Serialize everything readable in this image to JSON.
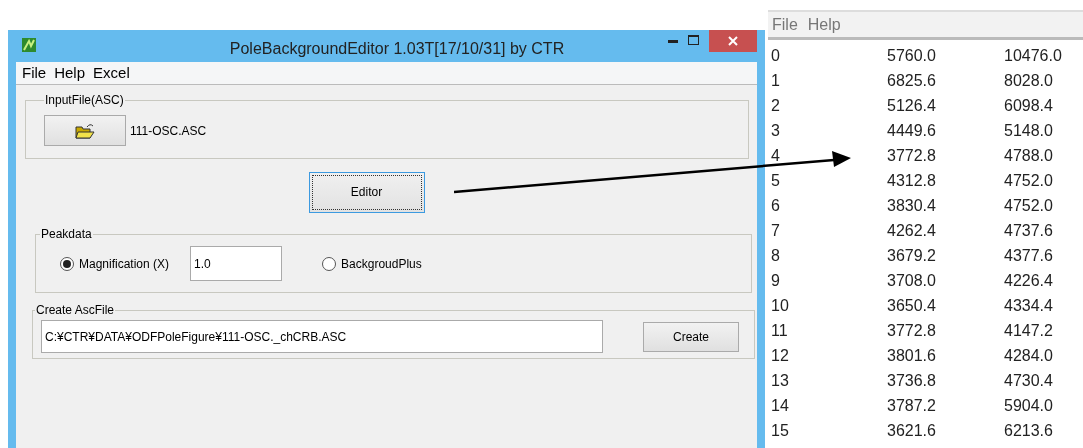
{
  "window": {
    "title": "PoleBackgroundEditor 1.03T[17/10/31] by CTR"
  },
  "menu": [
    "File",
    "Help",
    "Excel"
  ],
  "input_group": {
    "label": "InputFile(ASC)",
    "file_name": "111-OSC.ASC"
  },
  "editor_button": "Editor",
  "peakdata": {
    "label": "Peakdata",
    "options": [
      {
        "label": "Magnification (X)",
        "selected": true,
        "value": "1.0"
      },
      {
        "label": "BackgroudPlus",
        "selected": false
      }
    ]
  },
  "create_group": {
    "label": "Create AscFile",
    "path": "C:¥CTR¥DATA¥ODFPoleFigure¥111-OSC._chCRB.ASC",
    "button": "Create"
  },
  "data_window": {
    "menu": [
      "File",
      "Help"
    ],
    "rows": [
      [
        "0",
        "5760.0",
        "10476.0"
      ],
      [
        "1",
        "6825.6",
        "8028.0"
      ],
      [
        "2",
        "5126.4",
        "6098.4"
      ],
      [
        "3",
        "4449.6",
        "5148.0"
      ],
      [
        "4",
        "3772.8",
        "4788.0"
      ],
      [
        "5",
        "4312.8",
        "4752.0"
      ],
      [
        "6",
        "3830.4",
        "4752.0"
      ],
      [
        "7",
        "4262.4",
        "4737.6"
      ],
      [
        "8",
        "3679.2",
        "4377.6"
      ],
      [
        "9",
        "3708.0",
        "4226.4"
      ],
      [
        "10",
        "3650.4",
        "4334.4"
      ],
      [
        "11",
        "3772.8",
        "4147.2"
      ],
      [
        "12",
        "3801.6",
        "4284.0"
      ],
      [
        "13",
        "3736.8",
        "4730.4"
      ],
      [
        "14",
        "3787.2",
        "5904.0"
      ],
      [
        "15",
        "3621.6",
        "6213.6"
      ]
    ]
  }
}
